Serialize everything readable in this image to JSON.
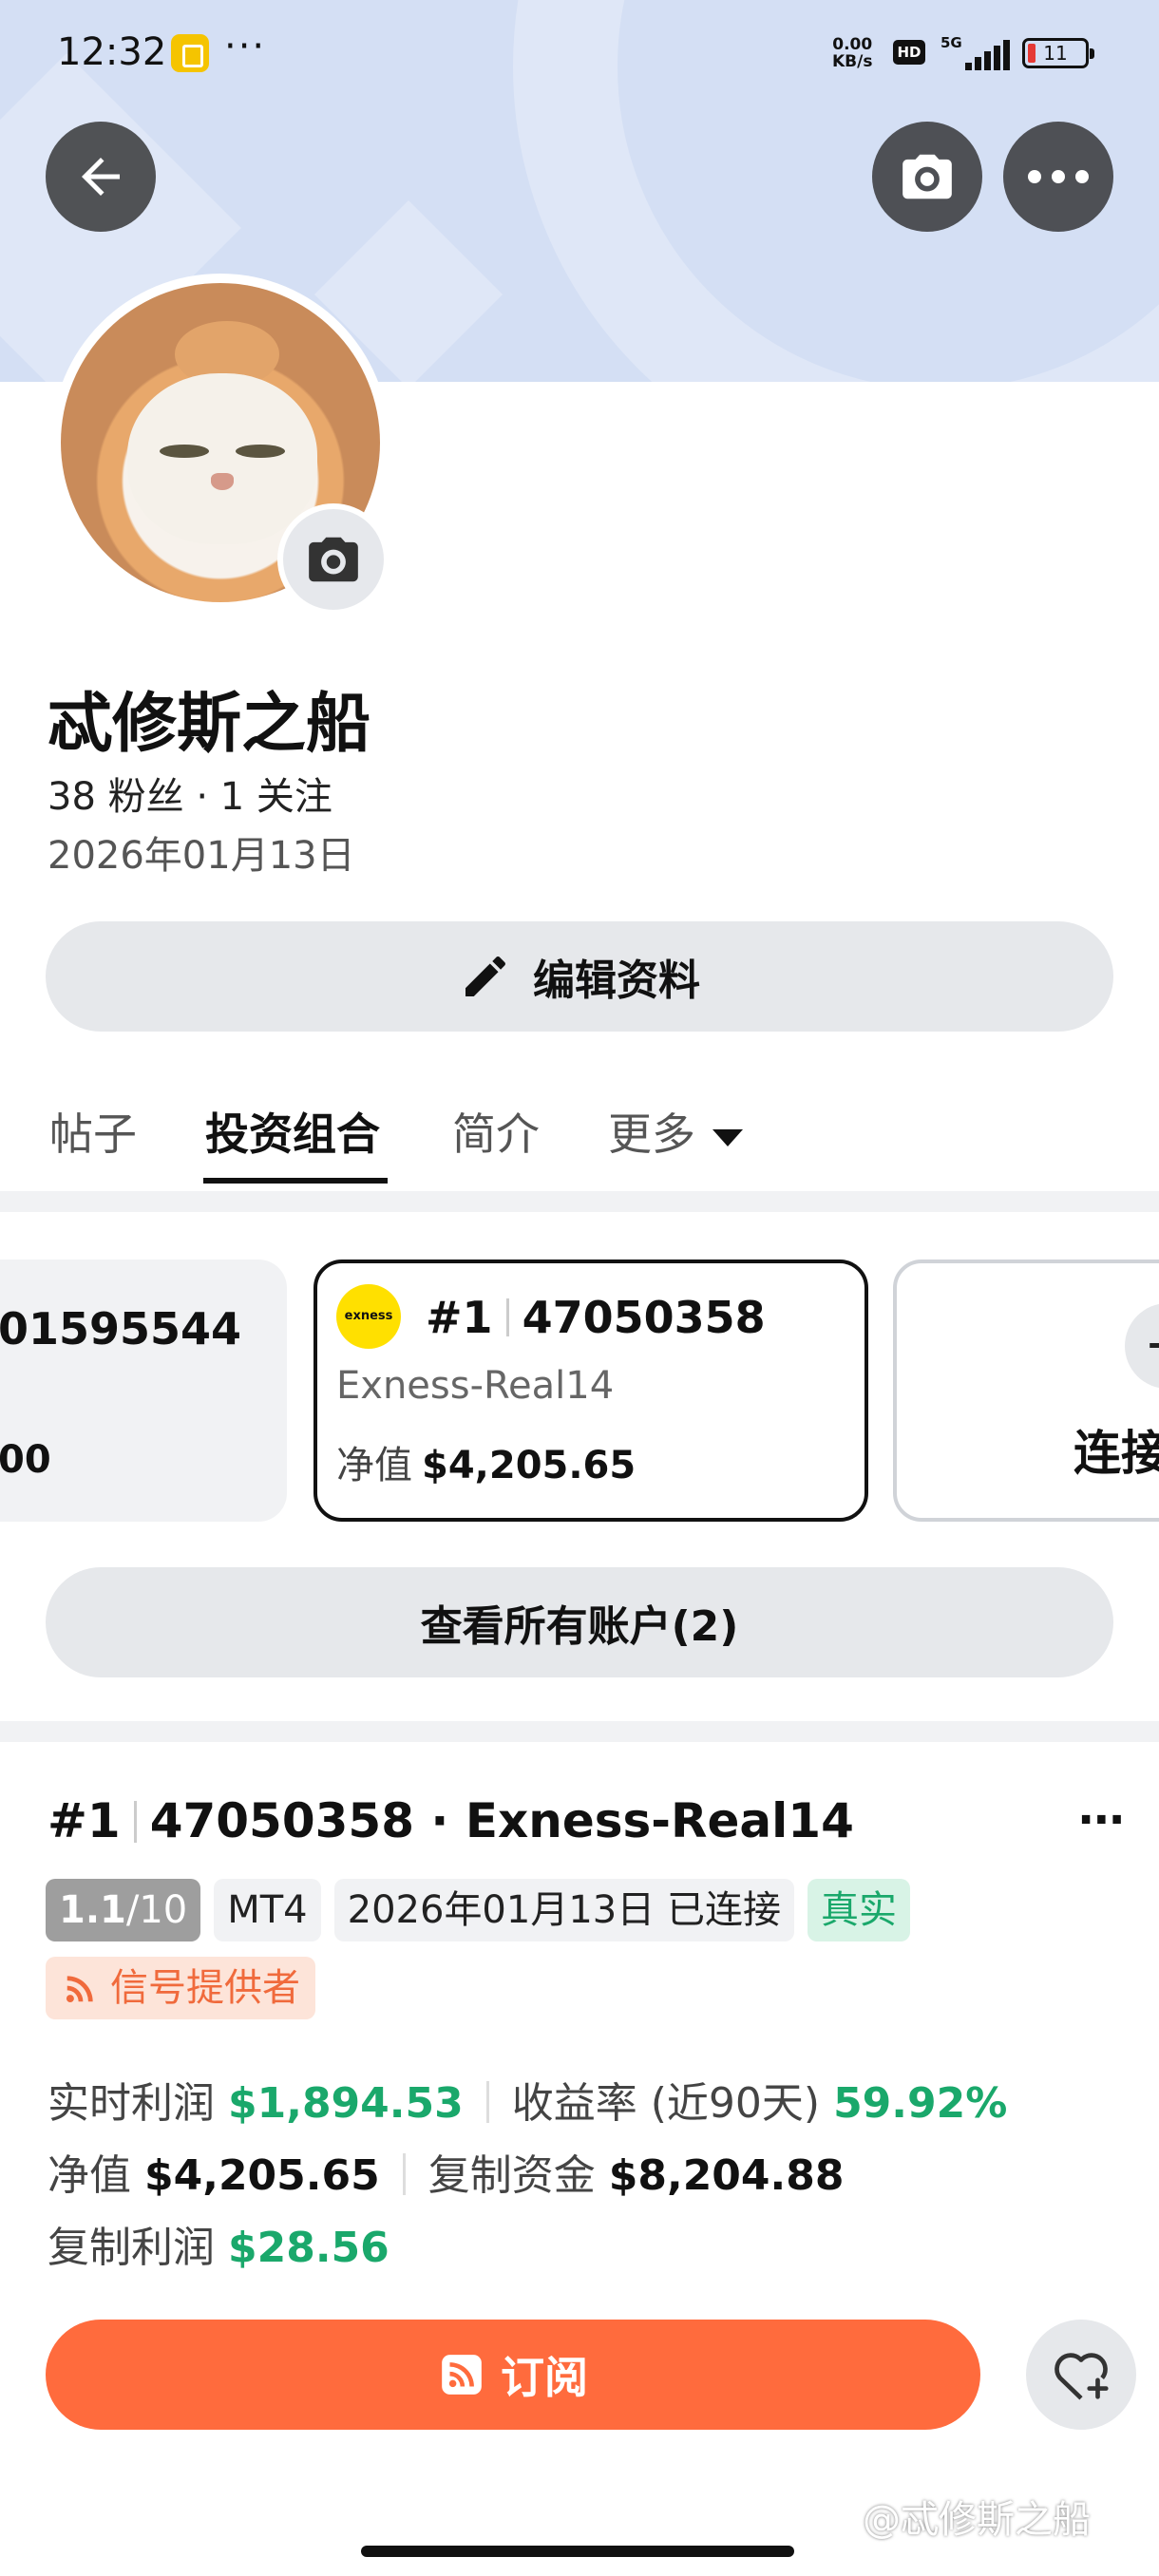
{
  "status_bar": {
    "time": "12:32",
    "dots": "···",
    "net_speed_value": "0.00",
    "net_speed_unit": "KB/s",
    "hd": "HD",
    "network": "5G",
    "battery": "11"
  },
  "profile": {
    "name": "忒修斯之船",
    "stats": "38 粉丝 · 1 关注",
    "joined": "2026年01月13日",
    "edit_label": "编辑资料"
  },
  "tabs": [
    {
      "label": "帖子"
    },
    {
      "label": "投资组合"
    },
    {
      "label": "简介"
    },
    {
      "label": "更多"
    }
  ],
  "accounts": {
    "left_card": {
      "number": "01595544",
      "value": "00"
    },
    "active_card": {
      "logo_text": "exness",
      "rank": "#1",
      "number": "47050358",
      "server": "Exness-Real14",
      "equity_label": "净值",
      "equity_value": "$4,205.65"
    },
    "connect_card": {
      "plus": "+",
      "label": "连接"
    },
    "view_all_label": "查看所有账户(2)"
  },
  "account_detail": {
    "rank": "#1",
    "title_rest": "47050358 · Exness-Real14",
    "more": "···",
    "level_strong": "1.1",
    "level_rest": "/10",
    "platform": "MT4",
    "connected": "2026年01月13日 已连接",
    "real": "真实",
    "signal_label": "信号提供者",
    "realtime_profit_label": "实时利润",
    "realtime_profit_value": "$1,894.53",
    "return_label": "收益率 (近90天)",
    "return_value": "59.92%",
    "equity_label": "净值",
    "equity_value": "$4,205.65",
    "copy_funds_label": "复制资金",
    "copy_funds_value": "$8,204.88",
    "copy_profit_label": "复制利润",
    "copy_profit_value": "$28.56",
    "subscribe_label": "订阅"
  },
  "watermark": "@忒修斯之船",
  "colors": {
    "banner": "#d4dff4",
    "accent_orange": "#ff6b3d",
    "profit_green": "#1aa86b",
    "exness_yellow": "#ffe000"
  },
  "icons": [
    "back-arrow-icon",
    "camera-icon",
    "more-icon",
    "pencil-icon",
    "caret-down-icon",
    "rss-icon",
    "heart-plus-icon"
  ]
}
